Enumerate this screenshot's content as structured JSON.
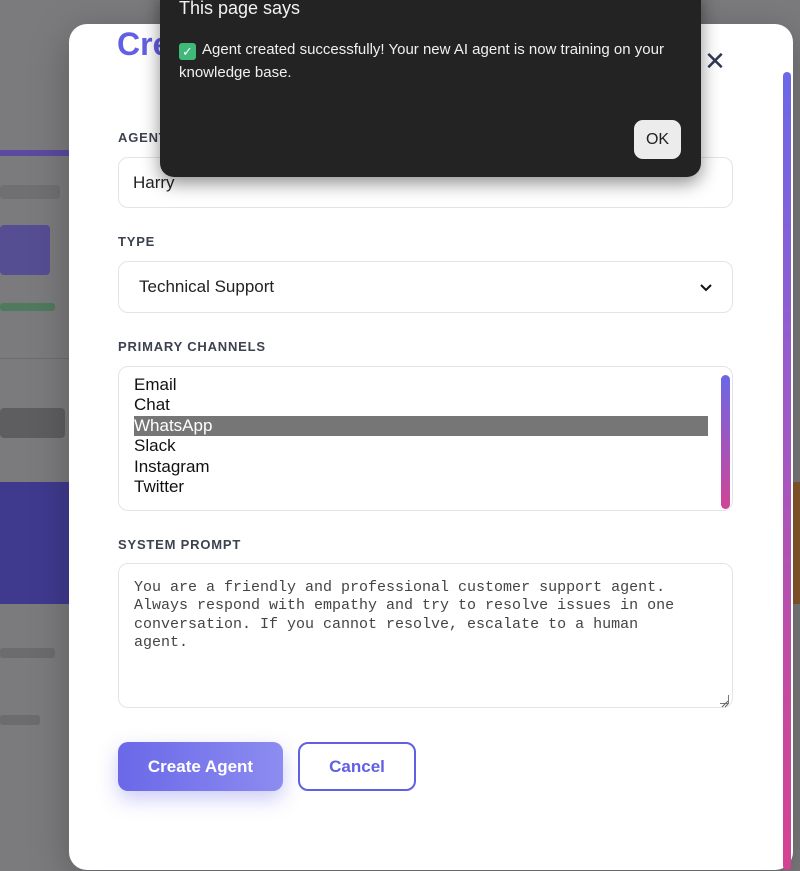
{
  "dialog": {
    "title": "This page says",
    "message": "Agent created successfully! Your new AI agent is now training on your knowledge base.",
    "check_icon": "✓",
    "ok_label": "OK"
  },
  "modal": {
    "title": "Create",
    "close_icon": "✕",
    "agent_name": {
      "label": "AGENT",
      "value": "Harry"
    },
    "type": {
      "label": "TYPE",
      "selected": "Technical Support",
      "chevron": "⌄"
    },
    "channels": {
      "label": "PRIMARY CHANNELS",
      "options": [
        "Email",
        "Chat",
        "WhatsApp",
        "Slack",
        "Instagram",
        "Twitter"
      ],
      "selected": "WhatsApp"
    },
    "system_prompt": {
      "label": "SYSTEM PROMPT",
      "value": "You are a friendly and professional customer support agent.\nAlways respond with empathy and try to resolve issues in one\nconversation. If you cannot resolve, escalate to a human\nagent."
    },
    "create_label": "Create Agent",
    "cancel_label": "Cancel"
  },
  "colors": {
    "accent": "#6160e4",
    "dialog_bg": "#232323",
    "success": "#3fb97a"
  }
}
